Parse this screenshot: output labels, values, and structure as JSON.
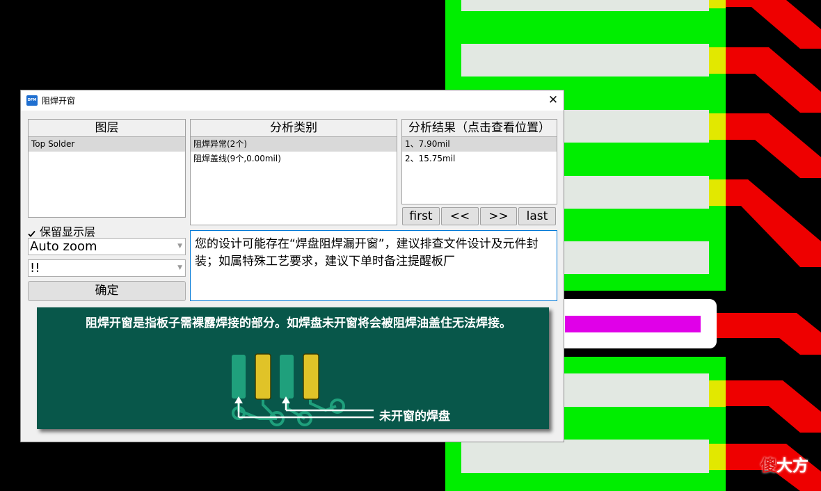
{
  "dialog": {
    "title": "阻焊开窗",
    "icon_label": "DFM",
    "close_glyph": "✕"
  },
  "layers": {
    "header": "图层",
    "items": [
      {
        "label": "Top Solder",
        "selected": true
      }
    ]
  },
  "categories": {
    "header": "分析类别",
    "items": [
      {
        "label": "阻焊异常(2个)",
        "selected": true
      },
      {
        "label": "阻焊盖线(9个,0.00mil)",
        "selected": false
      }
    ]
  },
  "results": {
    "header": "分析结果（点击查看位置）",
    "items": [
      {
        "label": "1、7.90mil",
        "selected": true
      },
      {
        "label": "2、15.75mil",
        "selected": false
      }
    ]
  },
  "nav": {
    "first": "first",
    "prev": "<<",
    "next": ">>",
    "last": "last"
  },
  "options": {
    "keep_layer_label": "保留显示层",
    "keep_layer_checked": true,
    "zoom_value": "Auto zoom",
    "severity_value": "!!",
    "ok_label": "确定"
  },
  "message": "您的设计可能存在“焊盘阻焊漏开窗”，建议排查文件设计及元件封装；如属特殊工艺要求，建议下单时备注提醒板厂",
  "illustration": {
    "text": "阻焊开窗是指板子需裸露焊接的部分。如焊盘未开窗将会被阻焊油盖住无法焊接。",
    "label": "未开窗的焊盘"
  },
  "watermark": {
    "prefix": "傻",
    "suffix": "大方"
  },
  "colors": {
    "pcb_black": "#000000",
    "pcb_green": "#00ee00",
    "pad_gray": "#e2e8e2",
    "trace_red": "#ee0000",
    "pad_yellow": "#e2e800",
    "magenta": "#e000e8",
    "board_green": "#08574a",
    "focus_blue": "#0078d7"
  }
}
